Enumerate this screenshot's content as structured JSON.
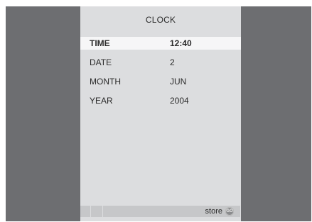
{
  "menu": {
    "title": "CLOCK",
    "rows": [
      {
        "label": "TIME",
        "value": "12:40"
      },
      {
        "label": "DATE",
        "value": "2"
      },
      {
        "label": "MONTH",
        "value": "JUN"
      },
      {
        "label": "YEAR",
        "value": "2004"
      }
    ],
    "selected_row": "TIME"
  },
  "footer": {
    "store_label": "store",
    "go_label": "GO"
  },
  "colors": {
    "background": "#6d6e71",
    "panel": "#dcdddf",
    "highlight": "#f6f6f7",
    "footer_bar": "#c6c7c9"
  }
}
